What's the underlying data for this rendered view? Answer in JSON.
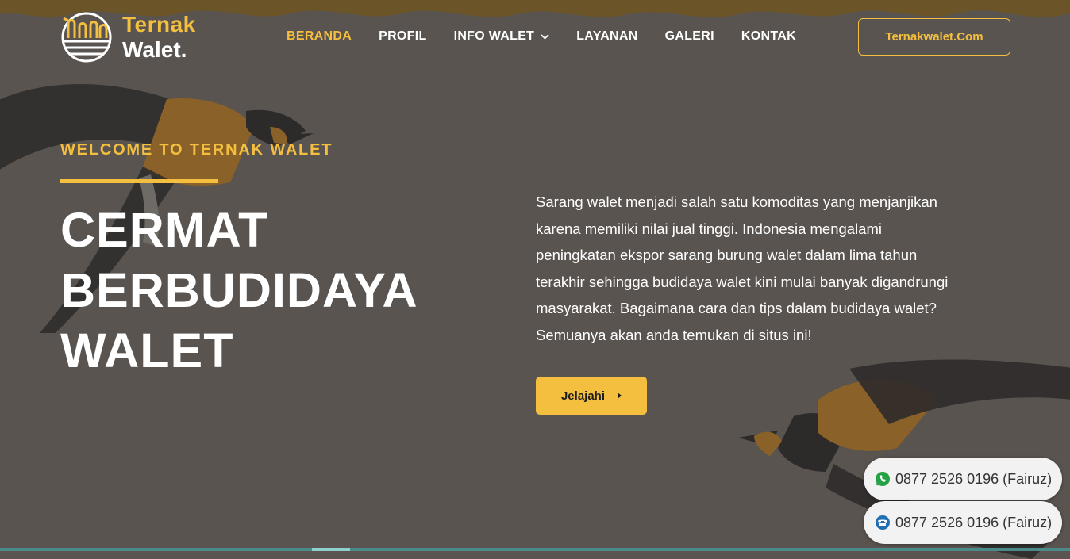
{
  "brand": {
    "line1": "Ternak",
    "line2": "Walet."
  },
  "nav": {
    "items": [
      {
        "label": "BERANDA",
        "active": true
      },
      {
        "label": "PROFIL"
      },
      {
        "label": "INFO WALET",
        "has_dropdown": true
      },
      {
        "label": "LAYANAN"
      },
      {
        "label": "GALERI"
      },
      {
        "label": "KONTAK"
      }
    ]
  },
  "header_button": "Ternakwalet.Com",
  "hero": {
    "eyebrow": "WELCOME TO TERNAK WALET",
    "title_lines": [
      "CERMAT",
      "BERBUDIDAYA",
      "WALET"
    ],
    "description": "Sarang walet menjadi salah satu komoditas yang menjanjikan karena memiliki nilai jual tinggi. Indonesia mengalami peningkatan ekspor sarang burung walet dalam lima tahun terakhir sehingga budidaya walet kini mulai banyak digandrungi masyarakat. Bagaimana cara dan tips dalam budidaya walet? Semuanya akan anda temukan di situs ini!",
    "button_label": "Jelajahi"
  },
  "contacts": [
    {
      "icon": "whatsapp-icon",
      "text": "0877 2526 0196 (Fairuz)"
    },
    {
      "icon": "phone-icon",
      "text": "0877 2526 0196 (Fairuz)"
    }
  ],
  "colors": {
    "background": "#5a5450",
    "accent": "#f4bf3f",
    "wave": "#7a5b24"
  }
}
